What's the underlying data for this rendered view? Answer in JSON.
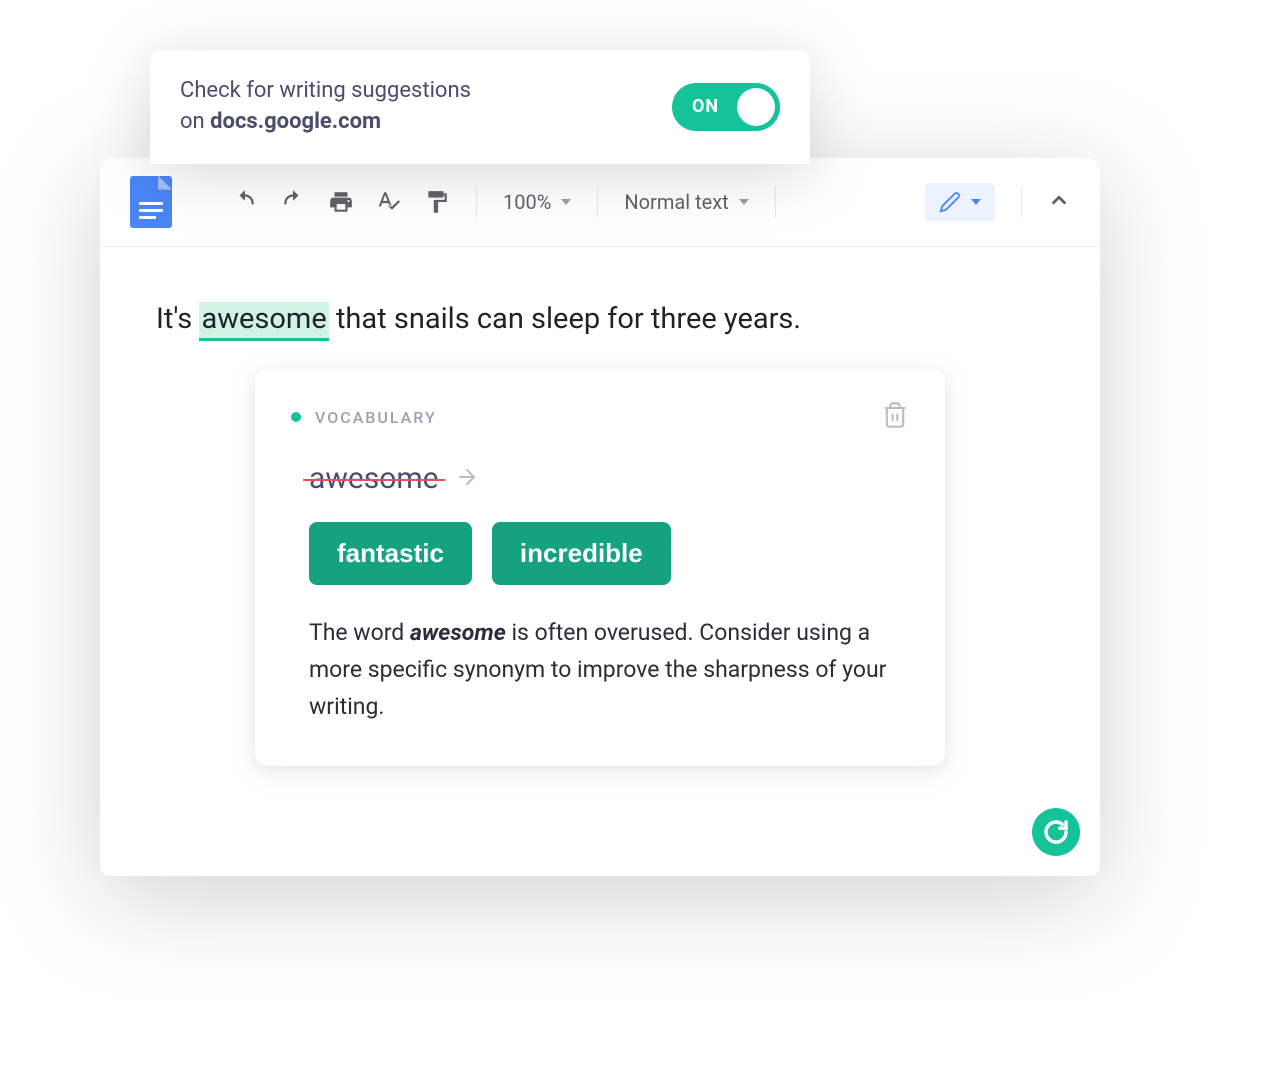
{
  "toggle": {
    "line1": "Check for writing suggestions",
    "line2_prefix": "on ",
    "domain": "docs.google.com",
    "state_label": "ON"
  },
  "toolbar": {
    "zoom": "100%",
    "style": "Normal text"
  },
  "document": {
    "prefix": "It's ",
    "highlighted": "awesome",
    "suffix": " that snails can sleep for three years."
  },
  "suggestion": {
    "category": "VOCABULARY",
    "original_word": "awesome",
    "alternatives": [
      "fantastic",
      "incredible"
    ],
    "explanation_pre": "The word ",
    "explanation_bold": "awesome",
    "explanation_post": " is often overused. Consider using a more specific synonym to improve the sharpness of your writing."
  }
}
